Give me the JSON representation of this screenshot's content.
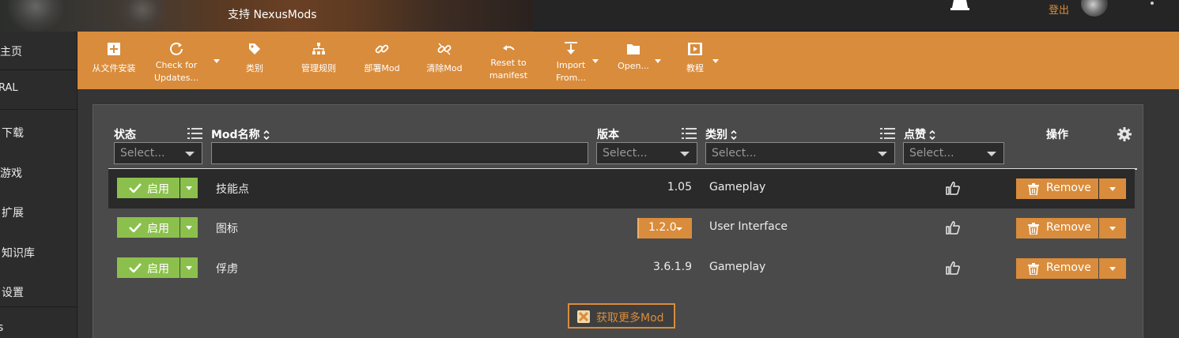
{
  "header": {
    "banner_text": "支持 NexusMods",
    "logout_label": "登出"
  },
  "sidebar": {
    "items": [
      {
        "label": "主页"
      },
      {
        "label": "RAL"
      },
      {
        "label": "下载"
      },
      {
        "label": "游戏"
      },
      {
        "label": "扩展"
      },
      {
        "label": "知识库"
      },
      {
        "label": "设置"
      },
      {
        "label": "s"
      }
    ]
  },
  "toolbar": {
    "install_from_file": "从文件安装",
    "check_updates_1": "Check for",
    "check_updates_2": "Updates...",
    "categories": "类别",
    "manage_rules": "管理规则",
    "deploy": "部署Mod",
    "purge": "清除Mod",
    "reset_1": "Reset to",
    "reset_2": "manifest",
    "import_1": "Import",
    "import_2": "From...",
    "open": "Open...",
    "tutorial": "教程"
  },
  "table": {
    "columns": {
      "status": "状态",
      "name": "Mod名称",
      "version": "版本",
      "category": "类别",
      "endorse": "点赞",
      "actions": "操作"
    },
    "select_placeholder": "Select...",
    "rows": [
      {
        "status": "启用",
        "name": "技能点",
        "version": "1.05",
        "category": "Gameplay",
        "remove": "Remove"
      },
      {
        "status": "启用",
        "name": "图标",
        "version": "1.2.0",
        "category": "User Interface",
        "remove": "Remove"
      },
      {
        "status": "启用",
        "name": "俘虏",
        "version": "3.6.1.9",
        "category": "Gameplay",
        "remove": "Remove"
      }
    ]
  },
  "more_mods": "获取更多Mod",
  "colors": {
    "accent": "#d98c3c",
    "enabled": "#8cc04d",
    "panel": "#4a4a4a"
  }
}
